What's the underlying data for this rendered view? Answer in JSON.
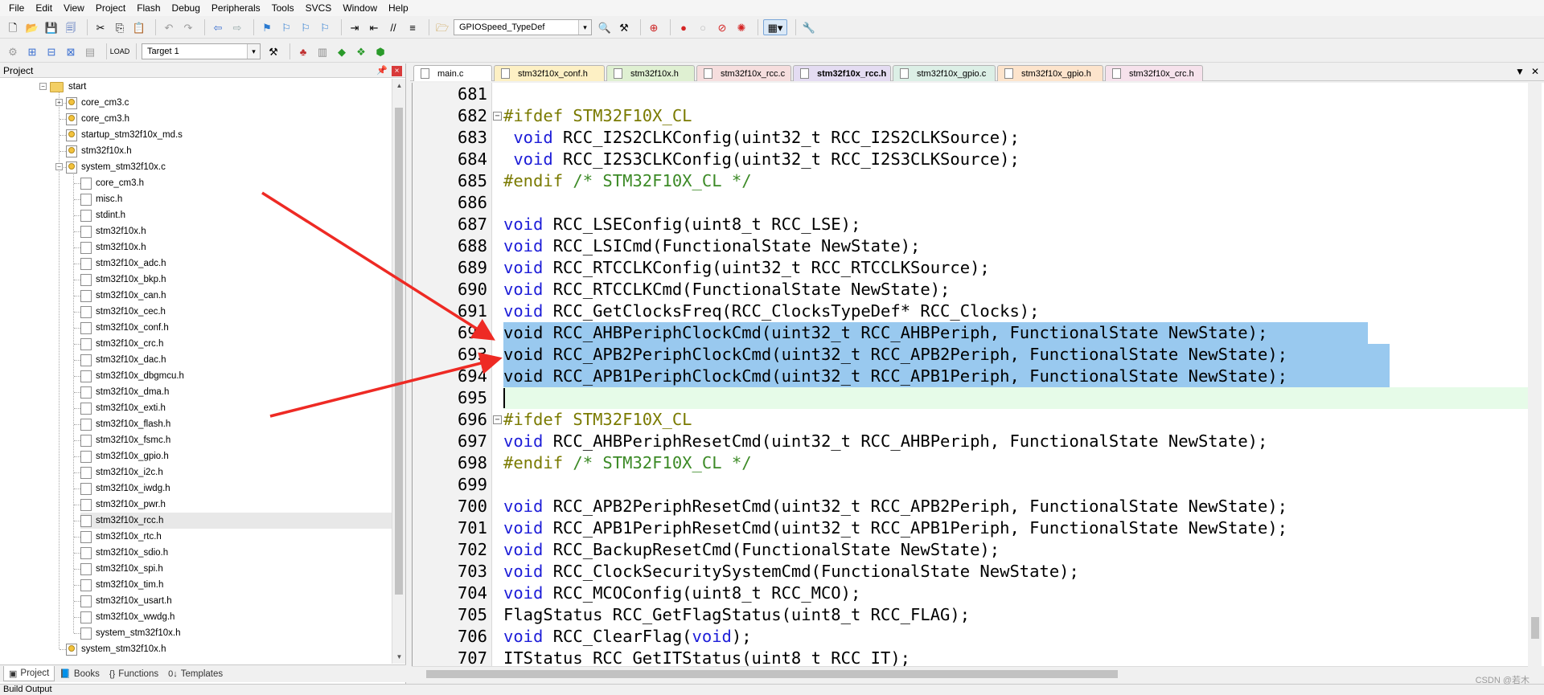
{
  "menu": [
    "File",
    "Edit",
    "View",
    "Project",
    "Flash",
    "Debug",
    "Peripherals",
    "Tools",
    "SVCS",
    "Window",
    "Help"
  ],
  "toolbar": {
    "find_combo": "GPIOSpeed_TypeDef",
    "target_combo": "Target 1"
  },
  "project_panel": {
    "title": "Project",
    "tabs": [
      {
        "label": "Project",
        "icon": "project-icon"
      },
      {
        "label": "Books",
        "icon": "books-icon"
      },
      {
        "label": "Functions",
        "icon": "functions-icon"
      },
      {
        "label": "Templates",
        "icon": "templates-icon"
      }
    ],
    "tree": [
      {
        "label": "start",
        "level": 0,
        "type": "folder",
        "expander": "−"
      },
      {
        "label": "core_cm3.c",
        "level": 1,
        "type": "file-key",
        "expander": "+"
      },
      {
        "label": "core_cm3.h",
        "level": 1,
        "type": "file-key"
      },
      {
        "label": "startup_stm32f10x_md.s",
        "level": 1,
        "type": "file-key"
      },
      {
        "label": "stm32f10x.h",
        "level": 1,
        "type": "file-key"
      },
      {
        "label": "system_stm32f10x.c",
        "level": 1,
        "type": "file-key",
        "expander": "−"
      },
      {
        "label": "core_cm3.h",
        "level": 2,
        "type": "file"
      },
      {
        "label": "misc.h",
        "level": 2,
        "type": "file"
      },
      {
        "label": "stdint.h",
        "level": 2,
        "type": "file"
      },
      {
        "label": "stm32f10x.h",
        "level": 2,
        "type": "file"
      },
      {
        "label": "stm32f10x.h",
        "level": 2,
        "type": "file"
      },
      {
        "label": "stm32f10x_adc.h",
        "level": 2,
        "type": "file"
      },
      {
        "label": "stm32f10x_bkp.h",
        "level": 2,
        "type": "file"
      },
      {
        "label": "stm32f10x_can.h",
        "level": 2,
        "type": "file"
      },
      {
        "label": "stm32f10x_cec.h",
        "level": 2,
        "type": "file"
      },
      {
        "label": "stm32f10x_conf.h",
        "level": 2,
        "type": "file"
      },
      {
        "label": "stm32f10x_crc.h",
        "level": 2,
        "type": "file"
      },
      {
        "label": "stm32f10x_dac.h",
        "level": 2,
        "type": "file"
      },
      {
        "label": "stm32f10x_dbgmcu.h",
        "level": 2,
        "type": "file"
      },
      {
        "label": "stm32f10x_dma.h",
        "level": 2,
        "type": "file"
      },
      {
        "label": "stm32f10x_exti.h",
        "level": 2,
        "type": "file"
      },
      {
        "label": "stm32f10x_flash.h",
        "level": 2,
        "type": "file"
      },
      {
        "label": "stm32f10x_fsmc.h",
        "level": 2,
        "type": "file"
      },
      {
        "label": "stm32f10x_gpio.h",
        "level": 2,
        "type": "file"
      },
      {
        "label": "stm32f10x_i2c.h",
        "level": 2,
        "type": "file"
      },
      {
        "label": "stm32f10x_iwdg.h",
        "level": 2,
        "type": "file"
      },
      {
        "label": "stm32f10x_pwr.h",
        "level": 2,
        "type": "file"
      },
      {
        "label": "stm32f10x_rcc.h",
        "level": 2,
        "type": "file",
        "selected": true
      },
      {
        "label": "stm32f10x_rtc.h",
        "level": 2,
        "type": "file"
      },
      {
        "label": "stm32f10x_sdio.h",
        "level": 2,
        "type": "file"
      },
      {
        "label": "stm32f10x_spi.h",
        "level": 2,
        "type": "file"
      },
      {
        "label": "stm32f10x_tim.h",
        "level": 2,
        "type": "file"
      },
      {
        "label": "stm32f10x_usart.h",
        "level": 2,
        "type": "file"
      },
      {
        "label": "stm32f10x_wwdg.h",
        "level": 2,
        "type": "file"
      },
      {
        "label": "system_stm32f10x.h",
        "level": 2,
        "type": "file"
      },
      {
        "label": "system_stm32f10x.h",
        "level": 1,
        "type": "file-key"
      }
    ]
  },
  "editor": {
    "tabs": [
      {
        "label": "main.c",
        "color": "#ffffff"
      },
      {
        "label": "stm32f10x_conf.h",
        "color": "#fdf0c4"
      },
      {
        "label": "stm32f10x.h",
        "color": "#dff0d2"
      },
      {
        "label": "stm32f10x_rcc.c",
        "color": "#f6dede"
      },
      {
        "label": "stm32f10x_rcc.h",
        "color": "#e4dcf2",
        "active": true
      },
      {
        "label": "stm32f10x_gpio.c",
        "color": "#dcefe6"
      },
      {
        "label": "stm32f10x_gpio.h",
        "color": "#fde4cc"
      },
      {
        "label": "stm32f10x_crc.h",
        "color": "#f6e2ec"
      }
    ],
    "lines": [
      {
        "n": "681",
        "seg": []
      },
      {
        "n": "682",
        "fold": "−",
        "seg": [
          [
            "pp",
            "#ifdef STM32F10X_CL"
          ]
        ]
      },
      {
        "n": "683",
        "seg": [
          [
            "",
            " "
          ],
          [
            "kw",
            "void"
          ],
          [
            "",
            " RCC_I2S2CLKConfig(uint32_t RCC_I2S2CLKSource);"
          ]
        ]
      },
      {
        "n": "684",
        "seg": [
          [
            "",
            " "
          ],
          [
            "kw",
            "void"
          ],
          [
            "",
            " RCC_I2S3CLKConfig(uint32_t RCC_I2S3CLKSource);"
          ]
        ]
      },
      {
        "n": "685",
        "seg": [
          [
            "pp",
            "#endif "
          ],
          [
            "cm",
            "/* STM32F10X_CL */"
          ]
        ]
      },
      {
        "n": "686",
        "seg": []
      },
      {
        "n": "687",
        "seg": [
          [
            "kw",
            "void"
          ],
          [
            "",
            " RCC_LSEConfig(uint8_t RCC_LSE);"
          ]
        ]
      },
      {
        "n": "688",
        "seg": [
          [
            "kw",
            "void"
          ],
          [
            "",
            " RCC_LSICmd(FunctionalState NewState);"
          ]
        ]
      },
      {
        "n": "689",
        "seg": [
          [
            "kw",
            "void"
          ],
          [
            "",
            " RCC_RTCCLKConfig(uint32_t RCC_RTCCLKSource);"
          ]
        ]
      },
      {
        "n": "690",
        "seg": [
          [
            "kw",
            "void"
          ],
          [
            "",
            " RCC_RTCCLKCmd(FunctionalState NewState);"
          ]
        ]
      },
      {
        "n": "691",
        "seg": [
          [
            "kw",
            "void"
          ],
          [
            "",
            " RCC_GetClocksFreq(RCC_ClocksTypeDef* RCC_Clocks);"
          ]
        ]
      },
      {
        "n": "692",
        "sel": true,
        "seg": [
          [
            "",
            "void RCC_AHBPeriphClockCmd(uint32_t RCC_AHBPeriph, FunctionalState NewState);"
          ]
        ]
      },
      {
        "n": "693",
        "sel": true,
        "seg": [
          [
            "",
            "void RCC_APB2PeriphClockCmd(uint32_t RCC_APB2Periph, FunctionalState NewState);"
          ]
        ]
      },
      {
        "n": "694",
        "sel": true,
        "seg": [
          [
            "",
            "void RCC_APB1PeriphClockCmd(uint32_t RCC_APB1Periph, FunctionalState NewState);"
          ]
        ]
      },
      {
        "n": "695",
        "cur": true,
        "seg": []
      },
      {
        "n": "696",
        "fold": "−",
        "seg": [
          [
            "pp",
            "#ifdef STM32F10X_CL"
          ]
        ]
      },
      {
        "n": "697",
        "seg": [
          [
            "kw",
            "void"
          ],
          [
            "",
            " RCC_AHBPeriphResetCmd(uint32_t RCC_AHBPeriph, FunctionalState NewState);"
          ]
        ]
      },
      {
        "n": "698",
        "seg": [
          [
            "pp",
            "#endif "
          ],
          [
            "cm",
            "/* STM32F10X_CL */"
          ]
        ]
      },
      {
        "n": "699",
        "seg": []
      },
      {
        "n": "700",
        "seg": [
          [
            "kw",
            "void"
          ],
          [
            "",
            " RCC_APB2PeriphResetCmd(uint32_t RCC_APB2Periph, FunctionalState NewState);"
          ]
        ]
      },
      {
        "n": "701",
        "seg": [
          [
            "kw",
            "void"
          ],
          [
            "",
            " RCC_APB1PeriphResetCmd(uint32_t RCC_APB1Periph, FunctionalState NewState);"
          ]
        ]
      },
      {
        "n": "702",
        "seg": [
          [
            "kw",
            "void"
          ],
          [
            "",
            " RCC_BackupResetCmd(FunctionalState NewState);"
          ]
        ]
      },
      {
        "n": "703",
        "seg": [
          [
            "kw",
            "void"
          ],
          [
            "",
            " RCC_ClockSecuritySystemCmd(FunctionalState NewState);"
          ]
        ]
      },
      {
        "n": "704",
        "seg": [
          [
            "kw",
            "void"
          ],
          [
            "",
            " RCC_MCOConfig(uint8_t RCC_MCO);"
          ]
        ]
      },
      {
        "n": "705",
        "seg": [
          [
            "",
            "FlagStatus RCC_GetFlagStatus(uint8_t RCC_FLAG);"
          ]
        ]
      },
      {
        "n": "706",
        "seg": [
          [
            "kw",
            "void"
          ],
          [
            "",
            " RCC_ClearFlag("
          ],
          [
            "kw",
            "void"
          ],
          [
            "",
            ");"
          ]
        ]
      },
      {
        "n": "707",
        "seg": [
          [
            "",
            "ITStatus RCC_GetITStatus(uint8_t RCC_IT);"
          ]
        ]
      }
    ]
  },
  "status_bar": {
    "text": "Build Output"
  },
  "watermark": "CSDN @若木",
  "colors": {
    "keyword": "#1d1dd8",
    "preprocessor": "#7a7a00",
    "comment": "#3c8a26",
    "selection": "#99c9ef",
    "current_line": "#e6fbe8",
    "arrow": "#ee2a24"
  }
}
